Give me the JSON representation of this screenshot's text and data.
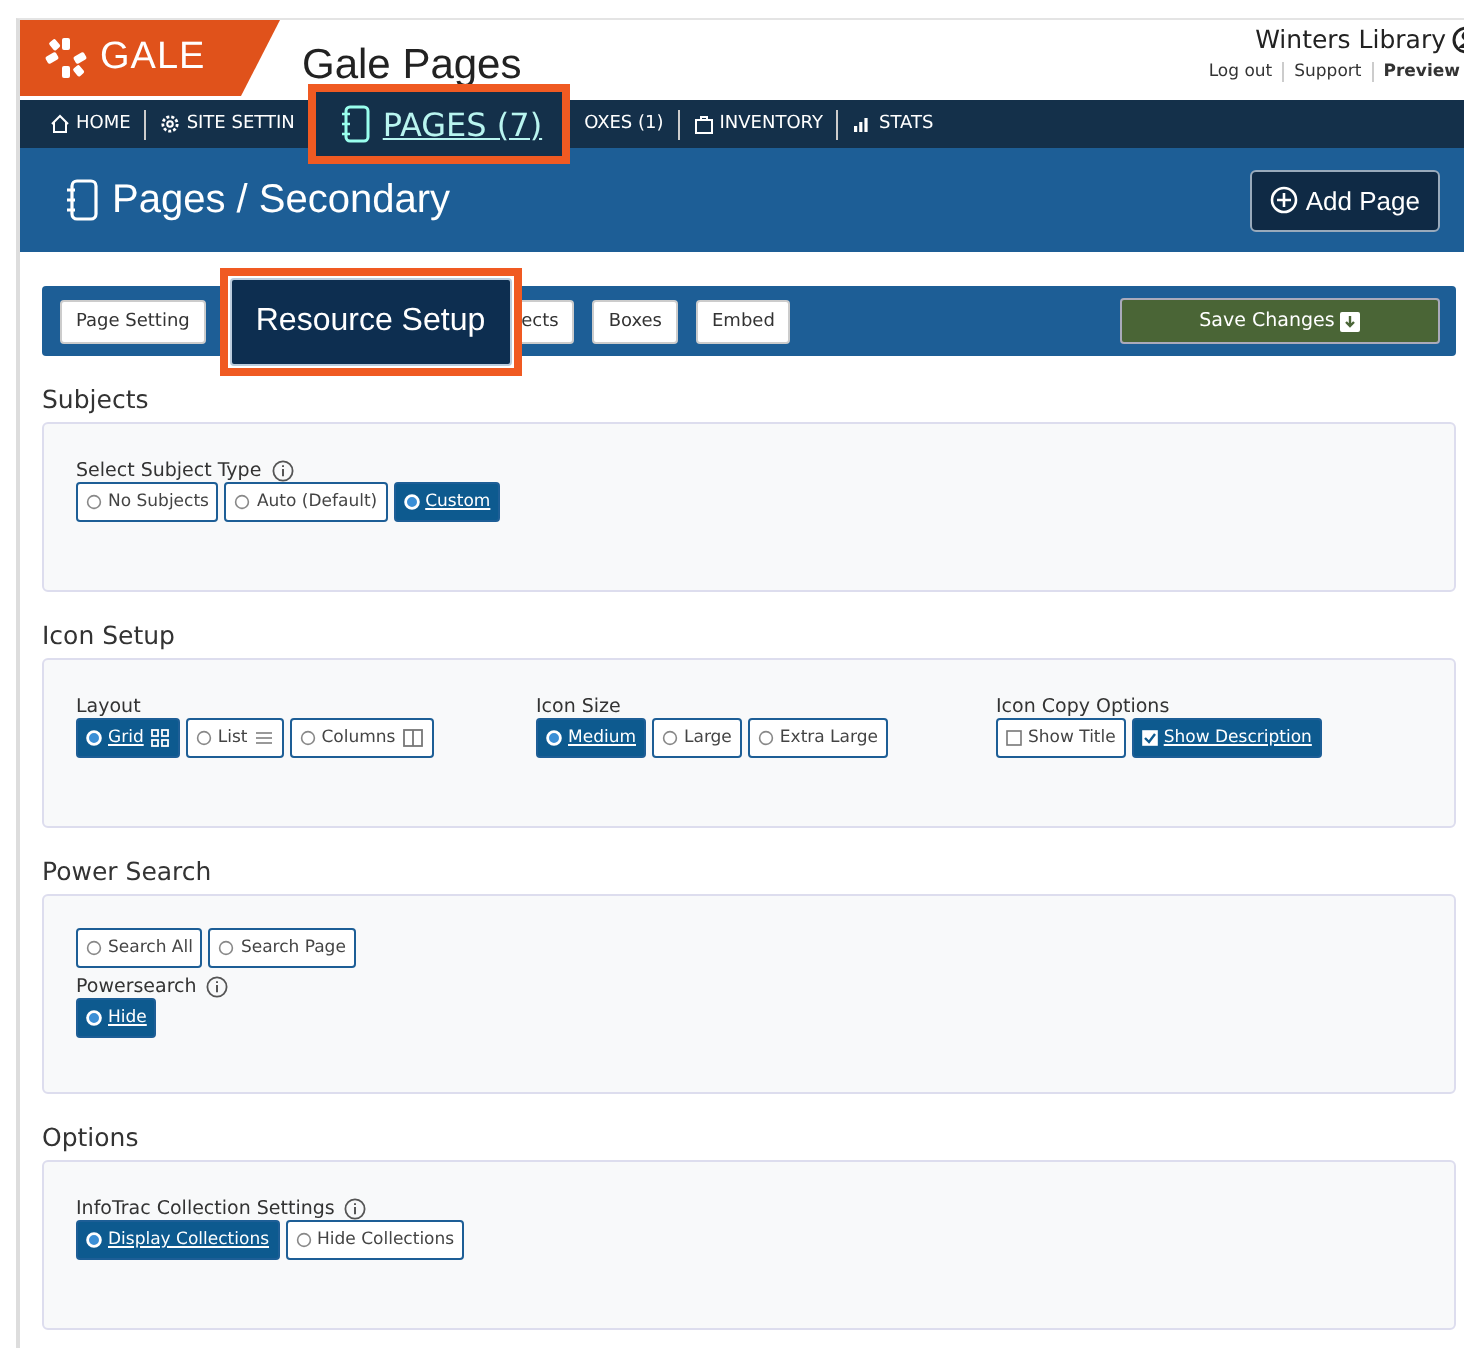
{
  "header": {
    "logo": "GALE",
    "app_title": "Gale Pages",
    "library": "Winters Library",
    "links": [
      "Log out",
      "Support",
      "Preview"
    ]
  },
  "nav": [
    {
      "label": "HOME",
      "kind": "item"
    },
    {
      "label": "SITE SETTIN",
      "kind": "item"
    },
    {
      "label": "PAGES (7)",
      "kind": "callout"
    },
    {
      "label": "OXES (1)",
      "kind": "item"
    },
    {
      "label": "INVENTORY",
      "kind": "item"
    },
    {
      "label": "STATS",
      "kind": "item"
    }
  ],
  "banner": {
    "title": "Pages / Secondary",
    "button": "Add Page"
  },
  "tabs": [
    {
      "label": "Page Setting",
      "selected": false,
      "kind": "tab"
    },
    {
      "label": "Resource Setup",
      "selected": true,
      "kind": "callout"
    },
    {
      "label": "ects",
      "selected": false,
      "kind": "tab"
    },
    {
      "label": "Boxes",
      "selected": false,
      "kind": "tab"
    },
    {
      "label": "Embed",
      "selected": false,
      "kind": "tab"
    }
  ],
  "save_button": "Save Changes",
  "sections": [
    {
      "heading": "Subjects",
      "kind": "row",
      "fields": [
        {
          "label": "Select Subject Type",
          "info": true,
          "options": [
            {
              "label": "No Subjects",
              "kind": "radio",
              "selected": false
            },
            {
              "label": "Auto (Default)",
              "kind": "radio",
              "selected": false
            },
            {
              "label": "Custom",
              "kind": "radio",
              "selected": true
            }
          ]
        }
      ]
    },
    {
      "heading": "Icon Setup",
      "kind": "row",
      "fields": [
        {
          "label": "Layout",
          "options": [
            {
              "label": "Grid",
              "kind": "radio",
              "selected": true
            },
            {
              "label": "List",
              "kind": "radio",
              "selected": false
            },
            {
              "label": "Columns",
              "kind": "radio",
              "selected": false
            }
          ]
        },
        {
          "label": "Icon Size",
          "options": [
            {
              "label": "Medium",
              "kind": "radio",
              "selected": true
            },
            {
              "label": "Large",
              "kind": "radio",
              "selected": false
            },
            {
              "label": "Extra Large",
              "kind": "radio",
              "selected": false
            }
          ]
        },
        {
          "label": "Icon Copy Options",
          "options": [
            {
              "label": "Show Title",
              "kind": "checkbox",
              "selected": false
            },
            {
              "label": "Show Description",
              "kind": "checkbox",
              "selected": true
            }
          ]
        }
      ]
    },
    {
      "heading": "Power Search",
      "kind": "stack",
      "fields": [
        {
          "options": [
            {
              "label": "Search All",
              "kind": "radio",
              "selected": false
            },
            {
              "label": "Search Page",
              "kind": "radio",
              "selected": false
            }
          ]
        },
        {
          "label": "Powersearch",
          "info": true,
          "options": [
            {
              "label": "Hide",
              "kind": "radio",
              "selected": true
            }
          ]
        }
      ]
    },
    {
      "heading": "Options",
      "kind": "row",
      "fields": [
        {
          "label": "InfoTrac Collection Settings",
          "info": true,
          "options": [
            {
              "label": "Display Collections",
              "kind": "radio",
              "selected": true
            },
            {
              "label": "Hide Collections",
              "kind": "radio",
              "selected": false
            }
          ]
        }
      ]
    }
  ]
}
